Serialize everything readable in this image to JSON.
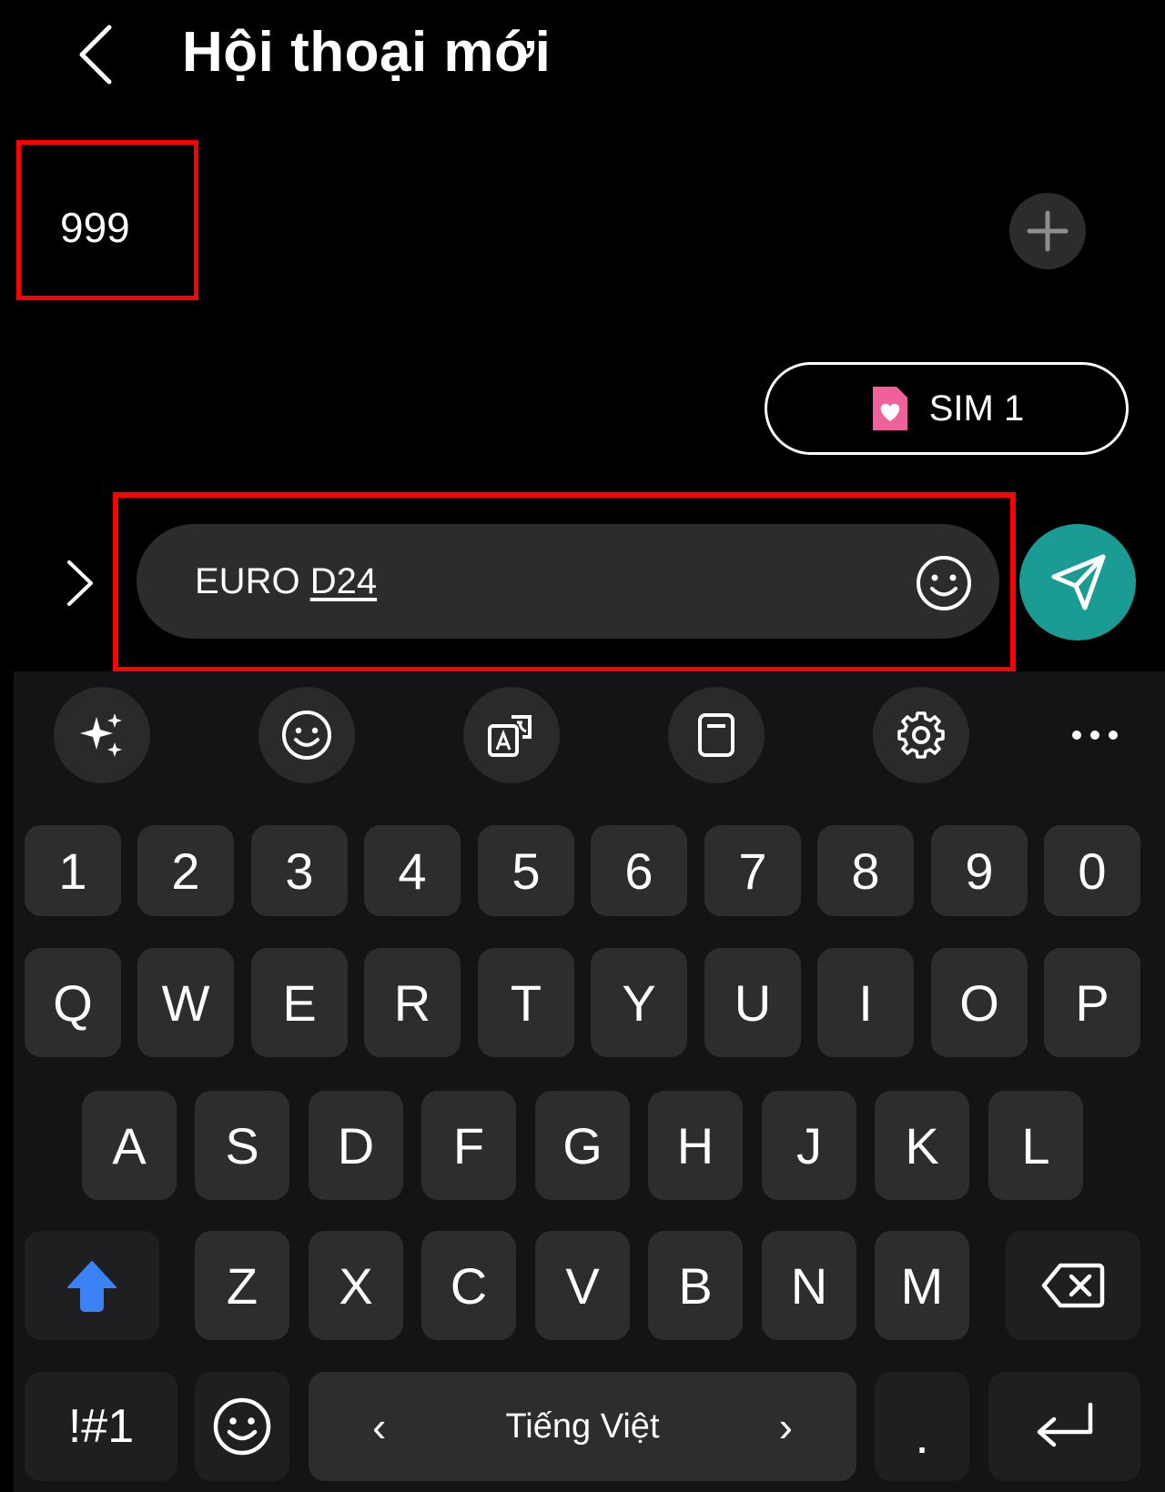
{
  "header": {
    "title": "Hội thoại mới"
  },
  "recipient": {
    "value": "999"
  },
  "sim": {
    "label": "SIM 1",
    "icon": "sim-heart-icon",
    "icon_color": "#f0609a"
  },
  "compose": {
    "text_plain": "EURO",
    "text_underlined": "D24"
  },
  "colors": {
    "highlight": "#ff0000",
    "send": "#1a9b94",
    "shift": "#3b82f6"
  },
  "toolbar": {
    "icons": [
      "sparkle-icon",
      "emoji-icon",
      "translate-icon",
      "clipboard-icon",
      "settings-icon",
      "more-icon"
    ]
  },
  "keyboard": {
    "row_numbers": [
      "1",
      "2",
      "3",
      "4",
      "5",
      "6",
      "7",
      "8",
      "9",
      "0"
    ],
    "row_q": [
      "Q",
      "W",
      "E",
      "R",
      "T",
      "Y",
      "U",
      "I",
      "O",
      "P"
    ],
    "row_a": [
      "A",
      "S",
      "D",
      "F",
      "G",
      "H",
      "J",
      "K",
      "L"
    ],
    "row_z": [
      "Z",
      "X",
      "C",
      "V",
      "B",
      "N",
      "M"
    ],
    "symbols": "!#1",
    "language": "Tiếng Việt",
    "period": "."
  }
}
